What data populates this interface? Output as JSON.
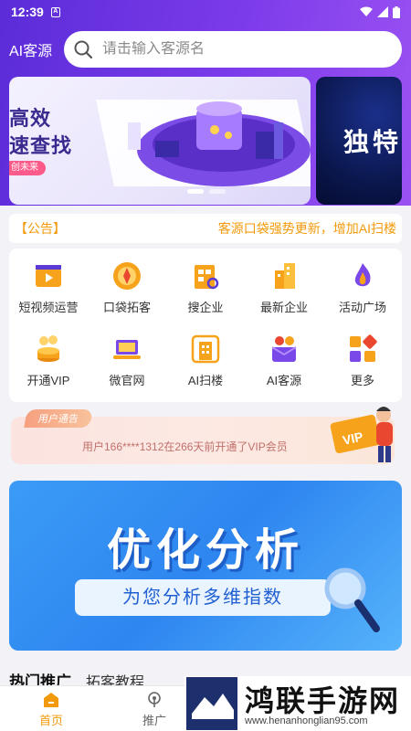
{
  "status_bar": {
    "time": "12:39",
    "app_icon": "A"
  },
  "header": {
    "brand": "AI客源",
    "search_placeholder": "请击输入客源名"
  },
  "banner": {
    "slogan_line1": "高效",
    "slogan_line2": "速查找",
    "tagline": "创未来",
    "next_slide_text": "独特"
  },
  "notice": {
    "tag": "【公告】",
    "message": "客源口袋强势更新，增加AI扫楼"
  },
  "grid": {
    "items": [
      {
        "label": "短视频运营",
        "icon": "film-clapper-icon"
      },
      {
        "label": "口袋拓客",
        "icon": "pocket-compass-icon"
      },
      {
        "label": "搜企业",
        "icon": "company-search-icon"
      },
      {
        "label": "最新企业",
        "icon": "new-building-icon"
      },
      {
        "label": "活动广场",
        "icon": "flame-trophy-icon"
      },
      {
        "label": "开通VIP",
        "icon": "vip-coins-icon"
      },
      {
        "label": "微官网",
        "icon": "laptop-web-icon"
      },
      {
        "label": "AI扫楼",
        "icon": "building-scan-icon"
      },
      {
        "label": "AI客源",
        "icon": "ai-customer-icon"
      },
      {
        "label": "更多",
        "icon": "more-blocks-icon"
      }
    ]
  },
  "vip_notice": {
    "badge": "用户通告",
    "text": "用户166****1312在266天前开通了VIP会员",
    "card_text": "VIP"
  },
  "promo": {
    "title": "优化分析",
    "subtitle": "为您分析多维指数"
  },
  "section_tabs": [
    {
      "label": "热门推广",
      "active": true
    },
    {
      "label": "拓客教程",
      "active": false
    }
  ],
  "bottom_nav": [
    {
      "label": "首页",
      "active": true
    },
    {
      "label": "推广",
      "active": false
    }
  ],
  "watermark": {
    "title": "鸿联手游网",
    "url": "www.henanhonglian95.com"
  },
  "colors": {
    "accent": "#f39a0c",
    "header_purple": "#6a34e0",
    "promo_blue": "#2e86f0"
  }
}
